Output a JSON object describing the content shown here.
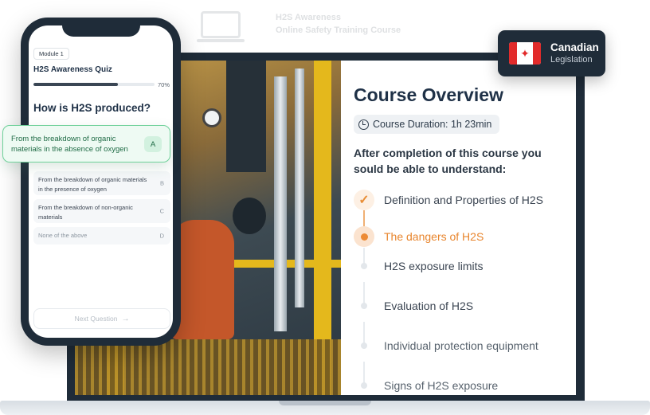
{
  "logo": {
    "line1": "H2S Awareness",
    "line2": "Online Safety Training Course"
  },
  "badge": {
    "title": "Canadian",
    "subtitle": "Legislation",
    "flag_icon": "canada-flag-icon"
  },
  "overview": {
    "title": "Course Overview",
    "duration": "Course Duration: 1h 23min",
    "subtitle": "After completion of this course you sould be able to understand:",
    "topics": [
      {
        "label": "Definition and Properties of H2S",
        "status": "done"
      },
      {
        "label": "The dangers of H2S",
        "status": "current"
      },
      {
        "label": "H2S exposure limits",
        "status": "todo"
      },
      {
        "label": "Evaluation of H2S",
        "status": "todo"
      },
      {
        "label": "Individual protection equipment",
        "status": "todo"
      },
      {
        "label": "Signs of H2S exposure",
        "status": "todo"
      }
    ]
  },
  "phone": {
    "module": "Module 1",
    "quiz_title": "H2S Awareness Quiz",
    "progress": 0.7,
    "progress_text": "70%",
    "question": "How is H2S produced?",
    "answer": {
      "text": "From the breakdown of organic materials in the absence of oxygen",
      "letter": "A"
    },
    "options": [
      {
        "text": "From the breakdown of organic materials in the presence of oxygen",
        "letter": "B"
      },
      {
        "text": "From the breakdown of non-organic materials",
        "letter": "C"
      },
      {
        "text": "None of the above",
        "letter": "D"
      }
    ],
    "next_label": "Next Question"
  },
  "colors": {
    "accent": "#e8852d",
    "dark": "#1f2c39",
    "correct": "#6fd19a"
  }
}
